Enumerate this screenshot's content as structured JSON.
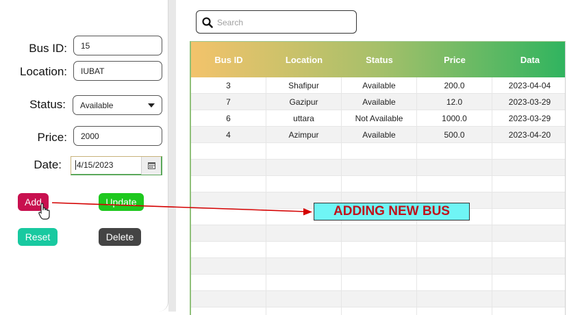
{
  "form": {
    "bus_id_label": "Bus ID:",
    "bus_id_value": "15",
    "location_label": "Location:",
    "location_value": "IUBAT",
    "status_label": "Status:",
    "status_value": "Available",
    "price_label": "Price:",
    "price_value": "2000",
    "date_label": "Date:",
    "date_value": "4/15/2023"
  },
  "buttons": {
    "add": "Add",
    "update": "Update",
    "reset": "Reset",
    "delete": "Delete"
  },
  "colors": {
    "add": "#c8104f",
    "update": "#1ec81e",
    "reset": "#18c9a0",
    "delete": "#444444",
    "annotation_bg": "#6ff5f5",
    "annotation_text": "#c0121b",
    "arrow": "#d40000"
  },
  "search": {
    "placeholder": "Search"
  },
  "table": {
    "headers": [
      "Bus ID",
      "Location",
      "Status",
      "Price",
      "Data"
    ],
    "rows": [
      [
        "3",
        "Shafipur",
        "Available",
        "200.0",
        "2023-04-04"
      ],
      [
        "7",
        "Gazipur",
        "Available",
        "12.0",
        "2023-03-29"
      ],
      [
        "6",
        "uttara",
        "Not Available",
        "1000.0",
        "2023-03-29"
      ],
      [
        "4",
        "Azimpur",
        "Available",
        "500.0",
        "2023-04-20"
      ]
    ]
  },
  "annotation": {
    "text": "ADDING NEW BUS"
  },
  "icons": {
    "search": "search-icon",
    "calendar": "calendar-icon",
    "dropdown": "chevron-down-icon",
    "cursor": "hand-pointer-icon"
  }
}
